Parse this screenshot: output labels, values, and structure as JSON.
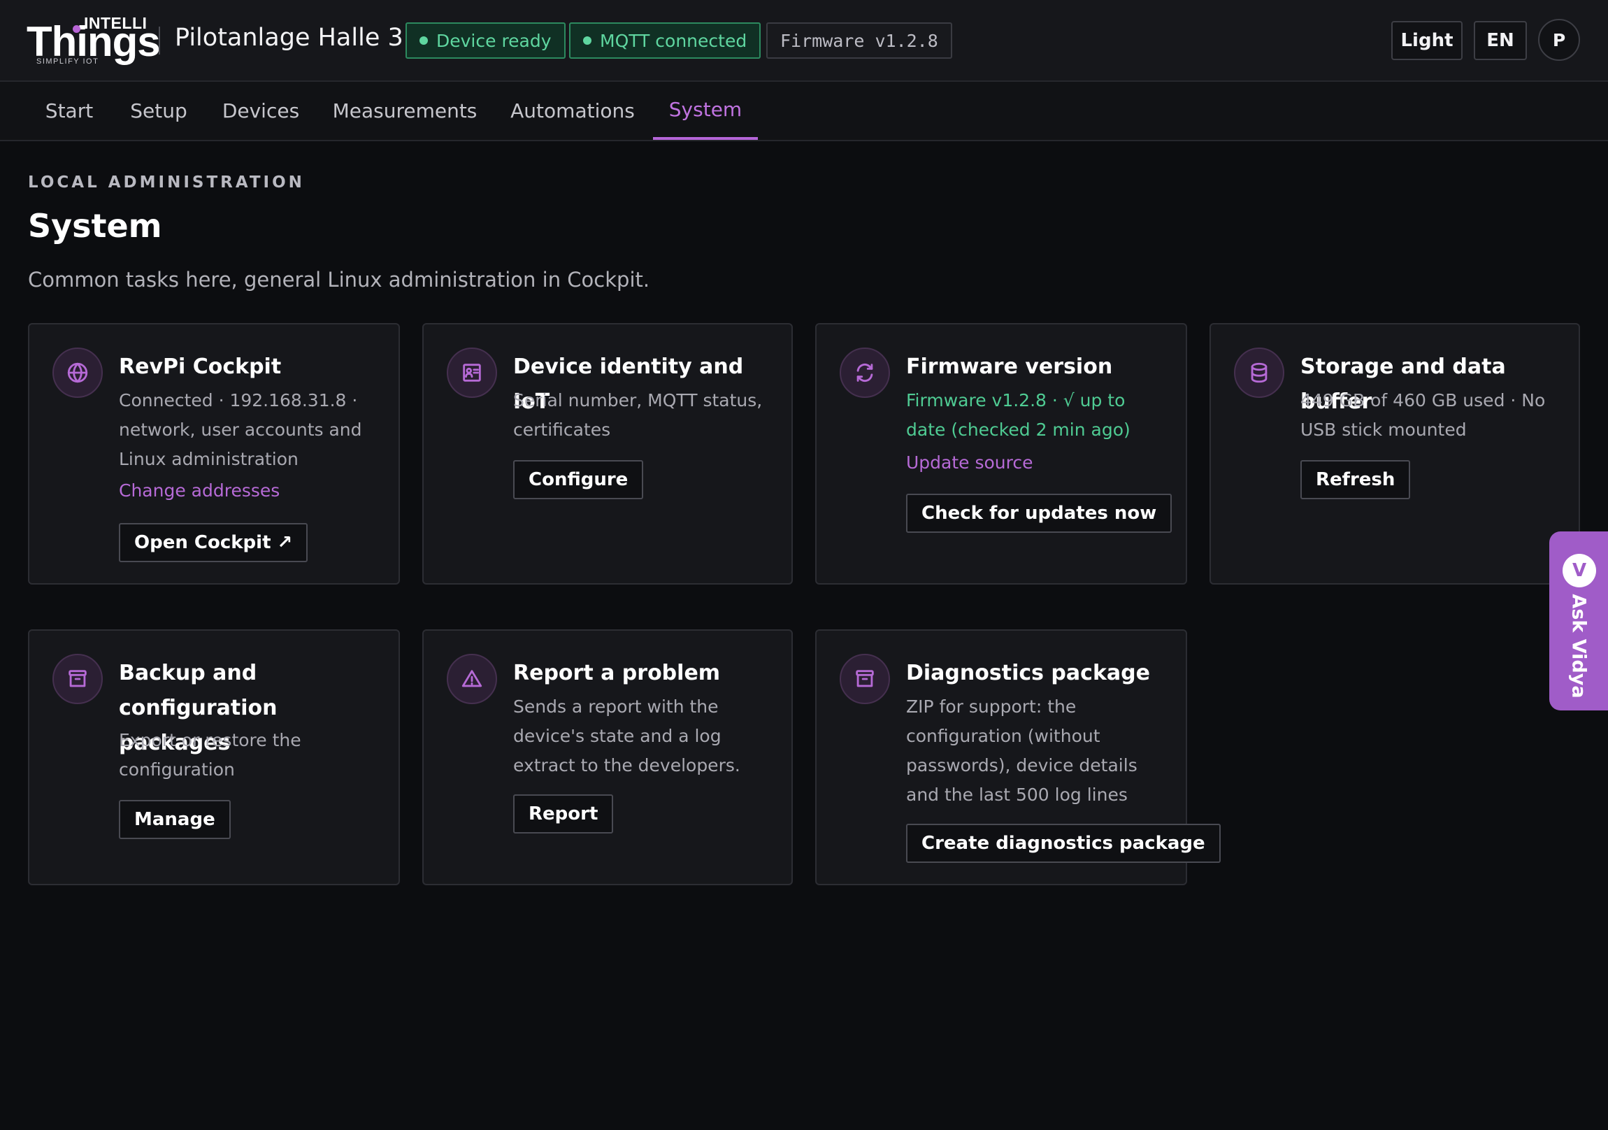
{
  "header": {
    "logo": {
      "top": "INTELLI",
      "main": "Things",
      "tagline": "SIMPLIFY IOT"
    },
    "site_title": "Pilotanlage Halle 3",
    "status": {
      "device": "Device ready",
      "mqtt": "MQTT connected",
      "firmware": "Firmware v1.2.8"
    },
    "theme_toggle": "Light",
    "language": "EN",
    "avatar_initial": "P"
  },
  "nav": {
    "tabs": [
      {
        "label": "Start"
      },
      {
        "label": "Setup"
      },
      {
        "label": "Devices"
      },
      {
        "label": "Measurements"
      },
      {
        "label": "Automations"
      },
      {
        "label": "System",
        "active": true
      }
    ]
  },
  "page": {
    "eyebrow": "LOCAL ADMINISTRATION",
    "title": "System",
    "description": "Common tasks here, general Linux administration in Cockpit."
  },
  "cards": {
    "cockpit": {
      "icon": "globe-icon",
      "title": "RevPi Cockpit",
      "text": "Connected · 192.168.31.8 · network, user accounts and Linux administration",
      "link": "Change addresses",
      "button": "Open Cockpit ↗"
    },
    "identity": {
      "icon": "id-card-icon",
      "title": "Device identity and IoT",
      "text": "Serial number, MQTT status, certificates",
      "button": "Configure"
    },
    "firmware": {
      "icon": "refresh-icon",
      "title": "Firmware version",
      "text": "Firmware v1.2.8 · √ up to date (checked 2 min ago)",
      "link": "Update source",
      "button": "Check for updates now"
    },
    "storage": {
      "icon": "database-icon",
      "title": "Storage and data buffer",
      "text": "449 GB of 460 GB used · No USB stick mounted",
      "button": "Refresh"
    },
    "backup": {
      "icon": "archive-icon",
      "title": "Backup and configuration packages",
      "text": "Export or restore the configuration",
      "button": "Manage"
    },
    "report": {
      "icon": "warning-icon",
      "title": "Report a problem",
      "text": "Sends a report with the device's state and a log extract to the developers.",
      "button": "Report"
    },
    "diagnostics": {
      "icon": "archive-icon",
      "title": "Diagnostics package",
      "text": "ZIP for support: the configuration (without passwords), device details and the last 500 log lines",
      "button": "Create diagnostics package"
    }
  },
  "assistant": {
    "badge": "V",
    "label": "Ask Vidya"
  },
  "colors": {
    "background": "#0c0d10",
    "accent": "#b66ad6",
    "success": "#4fcb93",
    "card": "#16171b"
  }
}
